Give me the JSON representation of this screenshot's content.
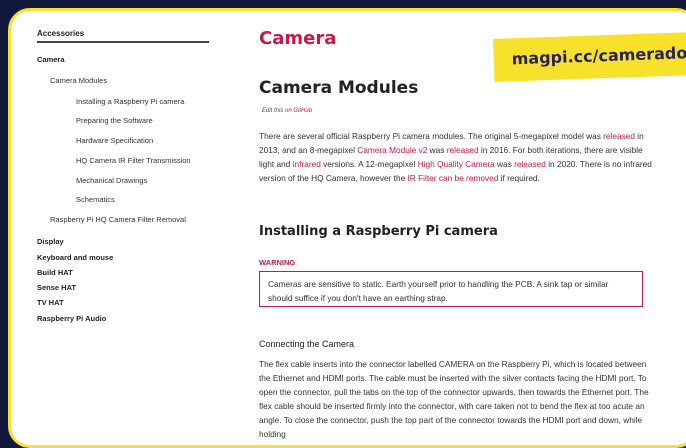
{
  "sidebar": {
    "title": "Accessories",
    "items": [
      {
        "label": "Camera"
      },
      {
        "label": "Camera Modules"
      },
      {
        "label": "Installing a Raspberry Pi camera"
      },
      {
        "label": "Preparing the Software"
      },
      {
        "label": "Hardware Specification"
      },
      {
        "label": "HQ Camera IR Filter Transmission"
      },
      {
        "label": "Mechanical Drawings"
      },
      {
        "label": "Schematics"
      },
      {
        "label": "Raspberry Pi HQ Camera Filter Removal"
      },
      {
        "label": "Display"
      },
      {
        "label": "Keyboard and mouse"
      },
      {
        "label": "Build HAT"
      },
      {
        "label": "Sense HAT"
      },
      {
        "label": "TV HAT"
      },
      {
        "label": "Raspberry Pi Audio"
      }
    ]
  },
  "main": {
    "page_title": "Camera",
    "section_title": "Camera Modules",
    "edit_prefix": "Edit this",
    "edit_link": "on GitHub",
    "intro": {
      "t1": "There are several official Raspberry Pi camera modules. The original 5-megapixel model was ",
      "l1": "released",
      "t2": " in 2013, and an 8-megapixel ",
      "l2": "Camera Module v2",
      "t3": " was ",
      "l3": "released",
      "t4": " in 2016. For both iterations, there are visible light and ",
      "l4": "infrared",
      "t5": " versions. A 12-megapixel ",
      "l5": "High Quality Camera",
      "t6": " was ",
      "l6": "released",
      "t7": " in 2020. There is no infrared version of the HQ Camera, however the ",
      "l7": "IR Filter can be removed",
      "t8": " if required."
    },
    "install_heading": "Installing a Raspberry Pi camera",
    "warning_label": "WARNING",
    "warning_text": "Cameras are sensitive to static. Earth yourself prior to handling the PCB. A sink tap or similar should suffice if you don't have an earthing strap.",
    "connect_heading": "Connecting the Camera",
    "connect_text": "The flex cable inserts into the connector labelled CAMERA on the Raspberry Pi, which is located between the Ethernet and HDMI ports. The cable must be inserted with the silver contacts facing the HDMI port. To open the connector, pull the tabs on the top of the connector upwards, then towards the Ethernet port. The flex cable should be inserted firmly into the connector, with care taken not to bend the flex at too acute an angle. To close the connector, push the top part of the connector towards the HDMI port and down, while holding"
  },
  "banner": {
    "text": "magpi.cc/camerado"
  },
  "colors": {
    "accent": "#c51a4a",
    "banner_bg": "#f7e12a",
    "frame": "#0f1a3d"
  }
}
